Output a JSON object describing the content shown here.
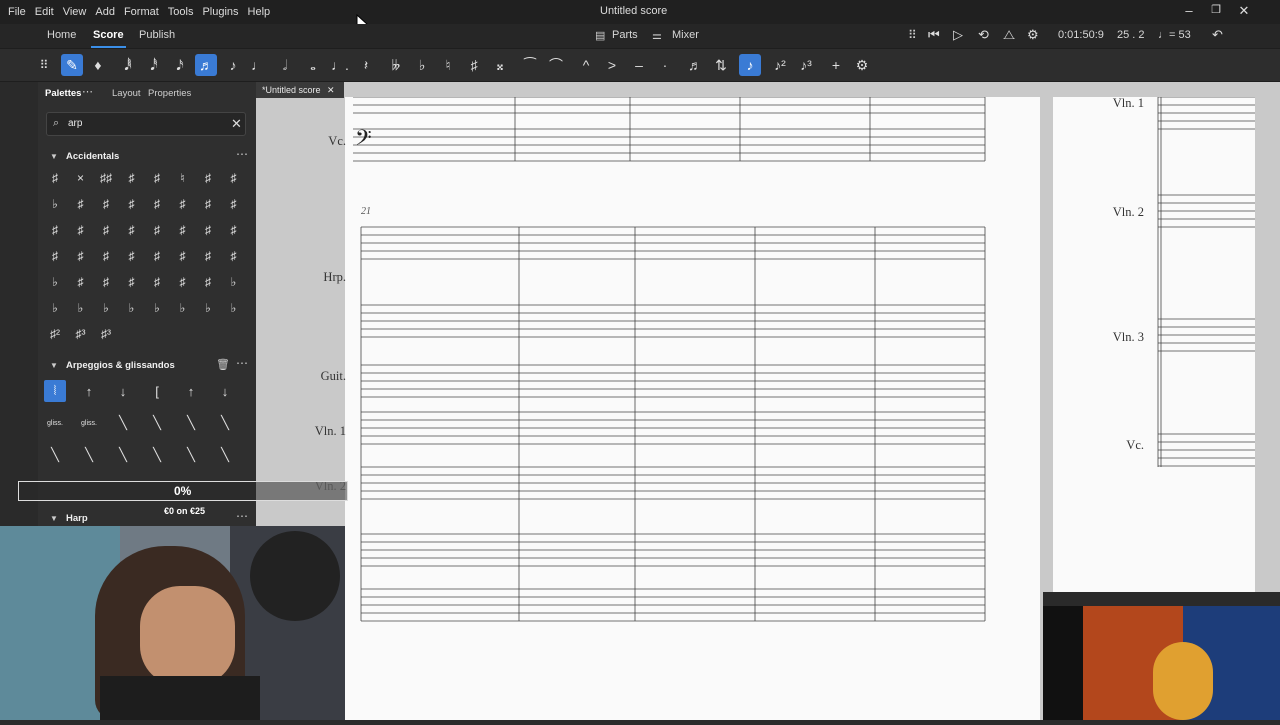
{
  "menu": [
    "File",
    "Edit",
    "View",
    "Add",
    "Format",
    "Tools",
    "Plugins",
    "Help"
  ],
  "app_title": "Untitled score",
  "tabs": [
    "Home",
    "Score",
    "Publish"
  ],
  "center_controls": {
    "parts": "Parts",
    "mixer": "Mixer"
  },
  "playback": {
    "time": "0:01:50:9",
    "position": "25 . 2",
    "tempo": "♩= 53"
  },
  "left_tabs": [
    "Palettes",
    "Layout",
    "Properties"
  ],
  "search": {
    "value": "arp"
  },
  "sections": {
    "accidentals": "Accidentals",
    "arpeggios": "Arpeggios & glissandos",
    "harp": "Harp"
  },
  "accidental_glyphs": [
    "♯",
    "×",
    "♯♯",
    "♯",
    "♯",
    "♮",
    "♯",
    "♯",
    "♭",
    "♯",
    "♯",
    "♯",
    "♯",
    "♯",
    "♯",
    "♯",
    "♯",
    "♯",
    "♯",
    "♯",
    "♯",
    "♯",
    "♯",
    "♯",
    "♯",
    "♯",
    "♯",
    "♯",
    "♯",
    "♯",
    "♯",
    "♯",
    "♭",
    "♯",
    "♯",
    "♯",
    "♯",
    "♯",
    "♯",
    "♭",
    "♭",
    "♭",
    "♭",
    "♭",
    "♭",
    "♭",
    "♭",
    "♭",
    "♯²",
    "♯³",
    "♯³"
  ],
  "arp_glyphs": [
    "⦚",
    "↑",
    "↓",
    "[",
    "↑",
    "↓",
    "gliss.",
    "gliss.",
    "╲",
    "╲",
    "╲",
    "╲",
    "╲",
    "╲",
    "╲",
    "╲",
    "╲",
    "╲"
  ],
  "document_tab": "*Untitled score",
  "instruments": {
    "vc_top": "Vc.",
    "hrp": "Hrp.",
    "guit": "Guit.",
    "vln1": "Vln. 1",
    "vln2": "Vln. 2",
    "p2_vln1": "Vln. 1",
    "p2_vln2": "Vln. 2",
    "p2_vln3": "Vln. 3",
    "p2_vc": "Vc."
  },
  "measure_number": "21",
  "overlay": {
    "percent": "0%",
    "goal": "€0 on €25"
  },
  "colors": {
    "accent": "#3a7bd5",
    "toolbar": "#2d2d2d",
    "panel": "#2f2f2f",
    "page": "#fafafa"
  }
}
